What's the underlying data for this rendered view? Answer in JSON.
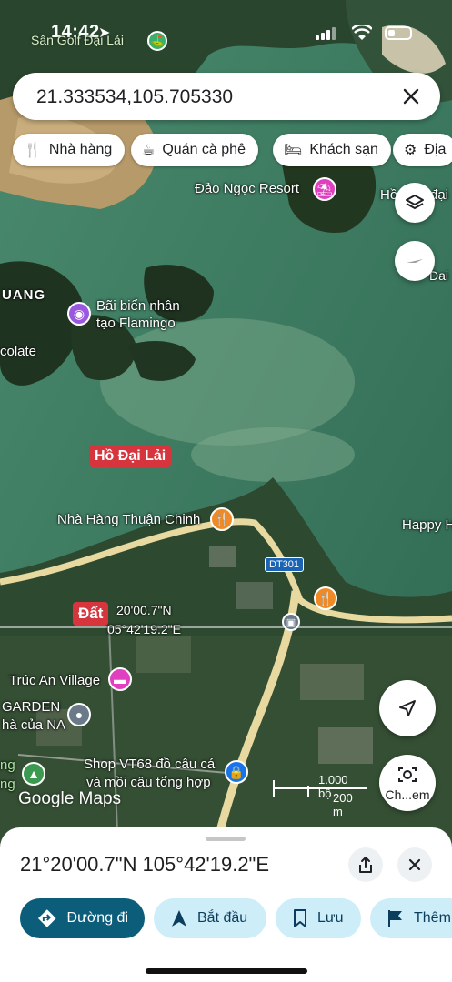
{
  "status_bar": {
    "time": "14:42",
    "app_back": "Sân Golf Đại Lải"
  },
  "search": {
    "query": "21.333534,105.705330"
  },
  "chips": [
    {
      "label": "Nhà hàng",
      "icon": "fork-knife-icon"
    },
    {
      "label": "Quán cà phê",
      "icon": "coffee-cup-icon"
    },
    {
      "label": "Khách sạn",
      "icon": "bed-icon"
    },
    {
      "label": "Địa",
      "icon": "landmark-icon"
    }
  ],
  "map": {
    "labels": {
      "dao_ngoc": "Đảo Ngọc Resort",
      "ho_right": "Hồ",
      "dai_top": "đại",
      "dai_side": "Dai",
      "uang": "UANG",
      "flamingo_line1": "Bãi biển nhân",
      "flamingo_line2": "tạo Flamingo",
      "colate": "colate",
      "ho_dai_lai": "Hồ Đại Lải",
      "thuan_chinh": "Nhà Hàng Thuận Chinh",
      "happy": "Happy H",
      "road": "DT301",
      "dat": "Đất",
      "pin_coord_1": "20'00.7\"N",
      "pin_coord_2": "05°42'19.2\"E",
      "truc_an": "Trúc An Village",
      "garden": "GARDEN",
      "nha_cua_na": "hà của NA",
      "shop_line1": "Shop VT68 đồ câu cá",
      "shop_line2": "và mồi câu tổng hợp",
      "green_left1": "ng",
      "green_left2": "ng"
    },
    "scale": {
      "feet": "1.000 bộ",
      "meters": "200 m"
    },
    "logo": "Google Maps",
    "lens_label": "Ch...em"
  },
  "sheet": {
    "title": "21°20'00.7\"N 105°42'19.2\"E",
    "actions": [
      {
        "label": "Đường đi",
        "icon": "directions-icon"
      },
      {
        "label": "Bắt đầu",
        "icon": "navigation-arrow-icon"
      },
      {
        "label": "Lưu",
        "icon": "bookmark-icon"
      },
      {
        "label": "Thêm",
        "icon": "flag-icon"
      }
    ]
  },
  "colors": {
    "water": "#3e7a60",
    "land_dark": "#26402a",
    "road": "#e8d9a0",
    "accent": "#0b5d7a",
    "secondary": "#cdeef8"
  }
}
